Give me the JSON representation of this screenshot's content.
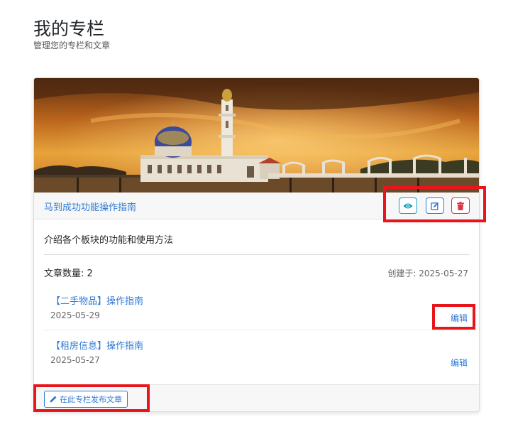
{
  "header": {
    "title": "我的专栏",
    "subtitle": "管理您的专栏和文章"
  },
  "column": {
    "title": "马到成功功能操作指南",
    "description": "介绍各个板块的功能和使用方法",
    "article_count_label": "文章数量: 2",
    "created_label": "创建于: 2025-05-27",
    "actions": [
      {
        "name": "view",
        "icon": "eye-icon",
        "color": "#17a2b8"
      },
      {
        "name": "edit",
        "icon": "edit-icon",
        "color": "#2f7ad6"
      },
      {
        "name": "delete",
        "icon": "trash-icon",
        "color": "#dc3545"
      }
    ],
    "articles": [
      {
        "title": "【二手物品】操作指南",
        "date": "2025-05-29",
        "edit_label": "编辑"
      },
      {
        "title": "【租房信息】操作指南",
        "date": "2025-05-27",
        "edit_label": "编辑"
      }
    ],
    "publish_label": "在此专栏发布文章"
  },
  "colors": {
    "accent": "#2f7ad6",
    "highlight": "#e8161a"
  }
}
